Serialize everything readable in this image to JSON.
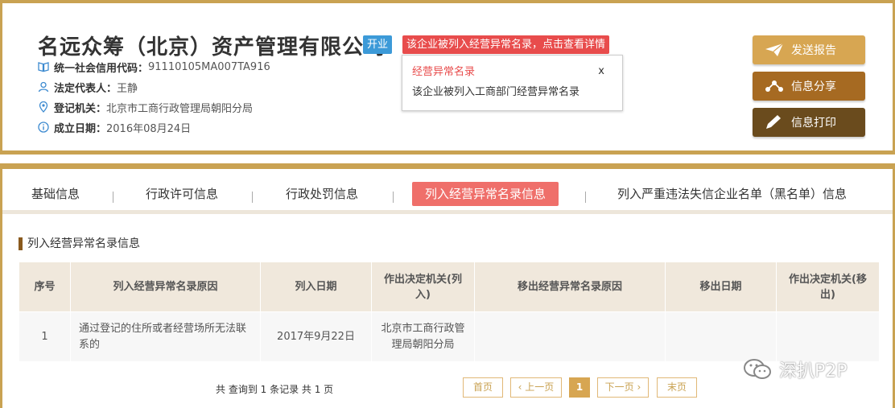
{
  "company": {
    "name": "名远众筹（北京）资产管理有限公司",
    "status": "开业",
    "abnormal_badge": "该企业被列入经营异常名录，点击查看详情",
    "tooltip": {
      "title": "经营异常名录",
      "close": "x",
      "body": "该企业被列入工商部门经营异常名录"
    },
    "info": [
      {
        "icon": "book-icon",
        "label": "统一社会信用代码：",
        "value": "91110105MA007TA916"
      },
      {
        "icon": "person-icon",
        "label": "法定代表人：",
        "value": "王静"
      },
      {
        "icon": "location-icon",
        "label": "登记机关：",
        "value": "北京市工商行政管理局朝阳分局"
      },
      {
        "icon": "info-icon",
        "label": "成立日期：",
        "value": "2016年08月24日"
      }
    ]
  },
  "actions": {
    "report": {
      "label": "发送报告",
      "icon": "paper-plane-icon"
    },
    "share": {
      "label": "信息分享",
      "icon": "share-icon"
    },
    "print": {
      "label": "信息打印",
      "icon": "pencil-icon"
    }
  },
  "tabs": [
    {
      "label": "基础信息",
      "active": false
    },
    {
      "label": "行政许可信息",
      "active": false
    },
    {
      "label": "行政处罚信息",
      "active": false
    },
    {
      "label": "列入经营异常名录信息",
      "active": true
    },
    {
      "label": "列入严重违法失信企业名单（黑名单）信息",
      "active": false
    }
  ],
  "section_title": "列入经营异常名录信息",
  "table": {
    "headers": [
      "序号",
      "列入经营异常名录原因",
      "列入日期",
      "作出决定机关(列入)",
      "移出经营异常名录原因",
      "移出日期",
      "作出决定机关(移出)"
    ],
    "rows": [
      [
        "1",
        "通过登记的住所或者经营场所无法联系的",
        "2017年9月22日",
        "北京市工商行政管理局朝阳分局",
        "",
        "",
        ""
      ]
    ]
  },
  "pager": {
    "summary": "共 查询到 1 条记录 共 1 页",
    "first": "首页",
    "prev": "上一页",
    "current": "1",
    "next": "下一页",
    "last": "末页"
  },
  "watermark": "深扒P2P",
  "colors": {
    "gold": "#c9a252",
    "status_blue": "#3c9ad8",
    "alert_red": "#e84c4c",
    "active_tab": "#ef6f6a",
    "btn_report": "#d7a652",
    "btn_share": "#a66a22",
    "btn_print": "#6a4b1d"
  }
}
